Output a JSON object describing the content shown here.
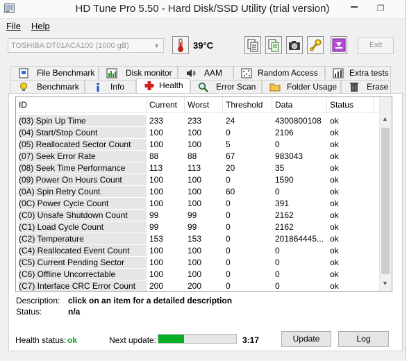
{
  "window": {
    "title": "HD Tune Pro 5.50 - Hard Disk/SSD Utility (trial version)",
    "maximize_symbol": "❐"
  },
  "menu": [
    {
      "label": "File"
    },
    {
      "label": "Help"
    }
  ],
  "toolbar": {
    "drive": "TOSHIBA DT01ACA100 (1000 gB)",
    "temperature": "39°C",
    "exit_label": "Exit",
    "buttons": [
      "copy-info-icon",
      "copy-text-icon",
      "camera-icon",
      "wrench-icon",
      "download-icon"
    ]
  },
  "tabs_top": [
    {
      "label": "File Benchmark",
      "icon": "file-benchmark-icon"
    },
    {
      "label": "Disk monitor",
      "icon": "disk-monitor-icon"
    },
    {
      "label": "AAM",
      "icon": "speaker-icon"
    },
    {
      "label": "Random Access",
      "icon": "random-access-icon"
    },
    {
      "label": "Extra tests",
      "icon": "extra-tests-icon"
    }
  ],
  "tabs_bottom": [
    {
      "label": "Benchmark",
      "icon": "lightbulb-icon"
    },
    {
      "label": "Info",
      "icon": "info-icon"
    },
    {
      "label": "Health",
      "icon": "red-cross-icon",
      "active": true
    },
    {
      "label": "Error Scan",
      "icon": "magnifier-icon"
    },
    {
      "label": "Folder Usage",
      "icon": "folder-icon"
    },
    {
      "label": "Erase",
      "icon": "trash-icon"
    }
  ],
  "table": {
    "columns": [
      "ID",
      "Current",
      "Worst",
      "Threshold",
      "Data",
      "Status"
    ],
    "rows": [
      [
        "(03) Spin Up Time",
        "233",
        "233",
        "24",
        "4300800108",
        "ok"
      ],
      [
        "(04) Start/Stop Count",
        "100",
        "100",
        "0",
        "2106",
        "ok"
      ],
      [
        "(05) Reallocated Sector Count",
        "100",
        "100",
        "5",
        "0",
        "ok"
      ],
      [
        "(07) Seek Error Rate",
        "88",
        "88",
        "67",
        "983043",
        "ok"
      ],
      [
        "(08) Seek Time Performance",
        "113",
        "113",
        "20",
        "35",
        "ok"
      ],
      [
        "(09) Power On Hours Count",
        "100",
        "100",
        "0",
        "1590",
        "ok"
      ],
      [
        "(0A) Spin Retry Count",
        "100",
        "100",
        "60",
        "0",
        "ok"
      ],
      [
        "(0C) Power Cycle Count",
        "100",
        "100",
        "0",
        "391",
        "ok"
      ],
      [
        "(C0) Unsafe Shutdown Count",
        "99",
        "99",
        "0",
        "2162",
        "ok"
      ],
      [
        "(C1) Load Cycle Count",
        "99",
        "99",
        "0",
        "2162",
        "ok"
      ],
      [
        "(C2) Temperature",
        "153",
        "153",
        "0",
        "201864445...",
        "ok"
      ],
      [
        "(C4) Reallocated Event Count",
        "100",
        "100",
        "0",
        "0",
        "ok"
      ],
      [
        "(C5) Current Pending Sector",
        "100",
        "100",
        "0",
        "0",
        "ok"
      ],
      [
        "(C6) Offline Uncorrectable",
        "100",
        "100",
        "0",
        "0",
        "ok"
      ],
      [
        "(C7) Interface CRC Error Count",
        "200",
        "200",
        "0",
        "0",
        "ok"
      ]
    ]
  },
  "details": {
    "description_label": "Description:",
    "description_value": "click on an item for a detailed description",
    "status_label": "Status:",
    "status_value": "n/a"
  },
  "footer": {
    "health_label": "Health status:",
    "health_value": "ok",
    "next_update_label": "Next update:",
    "progress_fraction": 0.33,
    "time": "3:17",
    "update_label": "Update",
    "log_label": "Log"
  },
  "colors": {
    "health_ok": "#0aa31b",
    "progress": "#06b025"
  }
}
